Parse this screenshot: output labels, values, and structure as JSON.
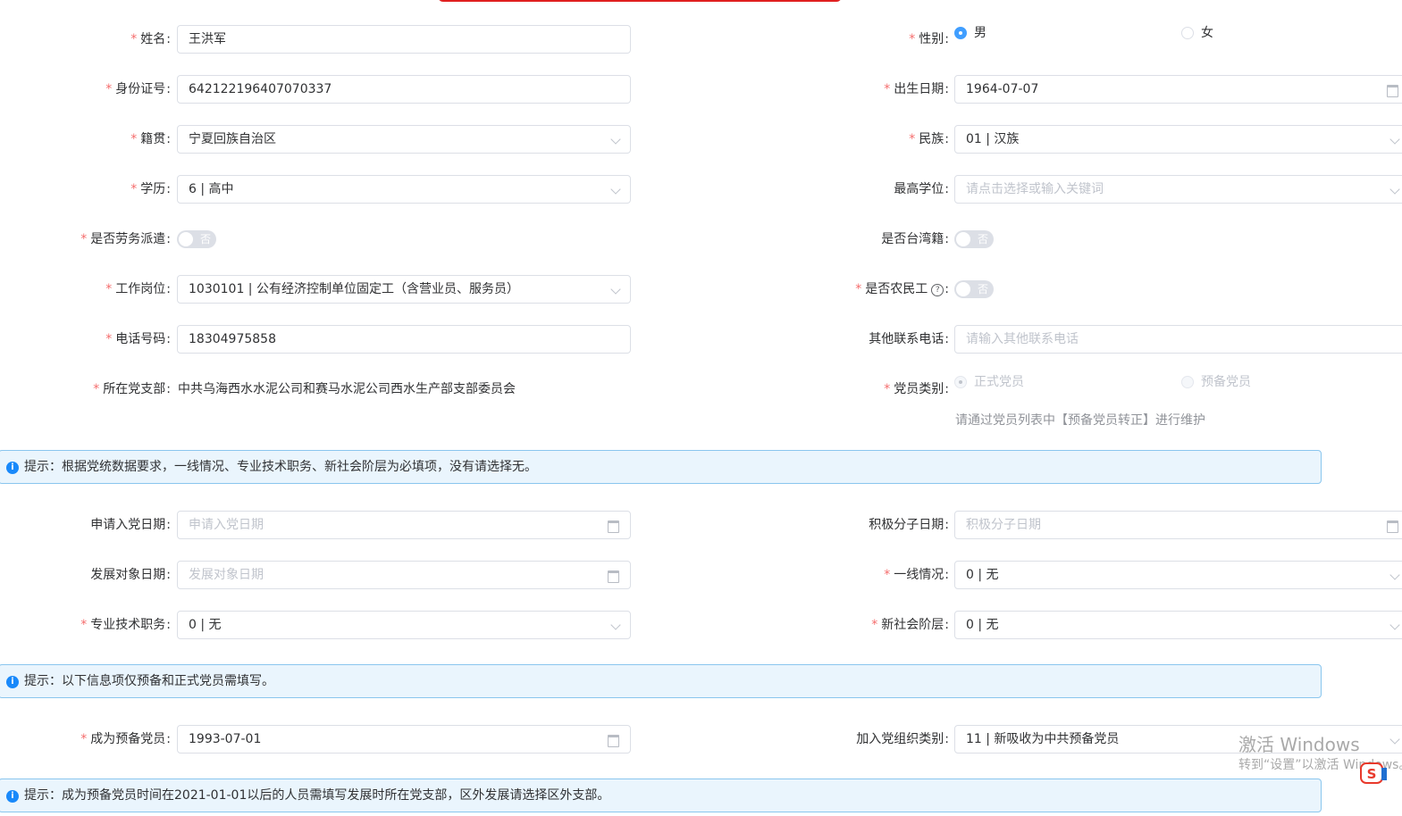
{
  "form": {
    "name": {
      "label": "姓名",
      "required": true,
      "value": "王洪军"
    },
    "gender": {
      "label": "性别",
      "required": true,
      "options": [
        "男",
        "女"
      ],
      "selected": "男"
    },
    "id_number": {
      "label": "身份证号",
      "required": true,
      "value": "642122196407070337"
    },
    "birth_date": {
      "label": "出生日期",
      "required": true,
      "value": "1964-07-07"
    },
    "native_place": {
      "label": "籍贯",
      "required": true,
      "value": "宁夏回族自治区"
    },
    "ethnicity": {
      "label": "民族",
      "required": true,
      "value": "01 | 汉族"
    },
    "education": {
      "label": "学历",
      "required": true,
      "value": "6 | 高中"
    },
    "highest_degree": {
      "label": "最高学位",
      "required": false,
      "placeholder": "请点击选择或输入关键词"
    },
    "labor_dispatch": {
      "label": "是否劳务派遣",
      "required": true,
      "switch_text": "否",
      "on": false
    },
    "taiwan_origin": {
      "label": "是否台湾籍",
      "required": false,
      "switch_text": "否",
      "on": false
    },
    "job_position": {
      "label": "工作岗位",
      "required": true,
      "value": "1030101 | 公有经济控制单位固定工（含营业员、服务员）"
    },
    "migrant_worker": {
      "label": "是否农民工",
      "required": true,
      "help_icon": "?",
      "switch_text": "否",
      "on": false
    },
    "phone": {
      "label": "电话号码",
      "required": true,
      "value": "18304975858"
    },
    "other_phone": {
      "label": "其他联系电话",
      "required": false,
      "placeholder": "请输入其他联系电话"
    },
    "party_branch": {
      "label": "所在党支部",
      "required": true,
      "value": "中共乌海西水水泥公司和赛马水泥公司西水生产部支部委员会"
    },
    "member_type": {
      "label": "党员类别",
      "required": true,
      "options": [
        "正式党员",
        "预备党员"
      ],
      "selected": "正式党员",
      "disabled": true,
      "note": "请通过党员列表中【预备党员转正】进行维护"
    },
    "apply_date": {
      "label": "申请入党日期",
      "required": false,
      "placeholder": "申请入党日期"
    },
    "activist_date": {
      "label": "积极分子日期",
      "required": false,
      "placeholder": "积极分子日期"
    },
    "development_date": {
      "label": "发展对象日期",
      "required": false,
      "placeholder": "发展对象日期"
    },
    "frontline": {
      "label": "一线情况",
      "required": true,
      "value": "0 | 无"
    },
    "professional_title": {
      "label": "专业技术职务",
      "required": true,
      "value": "0 | 无"
    },
    "new_social_class": {
      "label": "新社会阶层",
      "required": true,
      "value": "0 | 无"
    },
    "probationary_date": {
      "label": "成为预备党员",
      "required": true,
      "value": "1993-07-01"
    },
    "join_org_type": {
      "label": "加入党组织类别",
      "required": false,
      "value": "11 | 新吸收为中共预备党员"
    }
  },
  "alerts": {
    "a1": "提示：根据党统数据要求，一线情况、专业技术职务、新社会阶层为必填项，没有请选择无。",
    "a2": "提示：以下信息项仅预备和正式党员需填写。",
    "a3": "提示：成为预备党员时间在2021-01-01以后的人员需填写发展时所在党支部，区外发展请选择区外支部。"
  },
  "watermark": {
    "line1": "激活 Windows",
    "line2": "转到“设置”以激活 Windows。"
  },
  "colors": {
    "accent": "#409eff",
    "required": "#f56c6c",
    "alert_bg": "#eaf5fd",
    "alert_border": "#8ac6ee",
    "info_icon": "#1989fa"
  }
}
